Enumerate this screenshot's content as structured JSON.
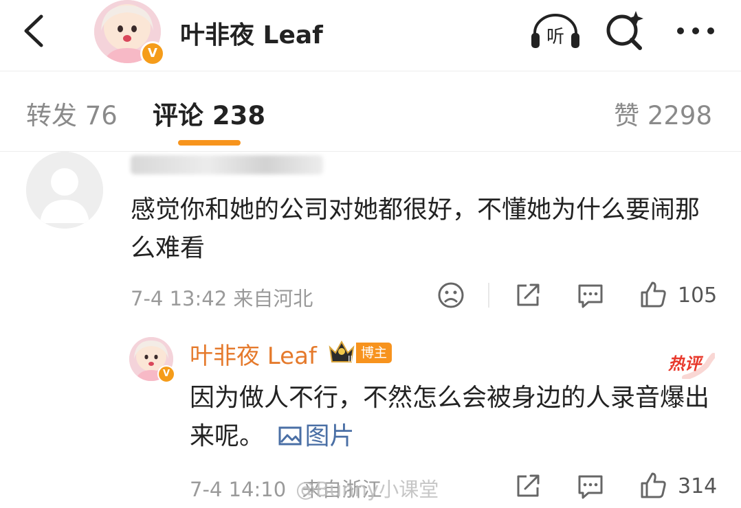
{
  "header": {
    "account_name": "叶非夜 Leaf",
    "listen_label": "听",
    "verified_badge": "V"
  },
  "tabs": {
    "repost": "转发 76",
    "comments": "评论 238",
    "likes": "赞 2298"
  },
  "comments": [
    {
      "text": "感觉你和她的公司对她都很好，不懂她为什么要闹那么难看",
      "meta": "7-4 13:42 来自河北",
      "like_count": "105"
    }
  ],
  "reply": {
    "author": "叶非夜 Leaf",
    "level_mark": "II",
    "role_badge": "博主",
    "hot_badge": "热评",
    "text": "因为做人不行，不然怎么会被身边的人录音爆出来呢。",
    "image_link": "图片",
    "meta_time": "7-4 14:10",
    "meta_location": "来自浙江",
    "like_count": "314"
  },
  "watermark": "@Bunny小课堂",
  "colors": {
    "accent_orange": "#f7941d",
    "author_name": "#e57a2c",
    "link_blue": "#4a6fa5",
    "hot_red": "#e8382b"
  },
  "icons": [
    "back-icon",
    "listen-icon",
    "search-sparkle-icon",
    "more-icon",
    "sad-face-icon",
    "share-icon",
    "comment-icon",
    "thumb-up-icon",
    "image-icon",
    "crown-icon"
  ]
}
